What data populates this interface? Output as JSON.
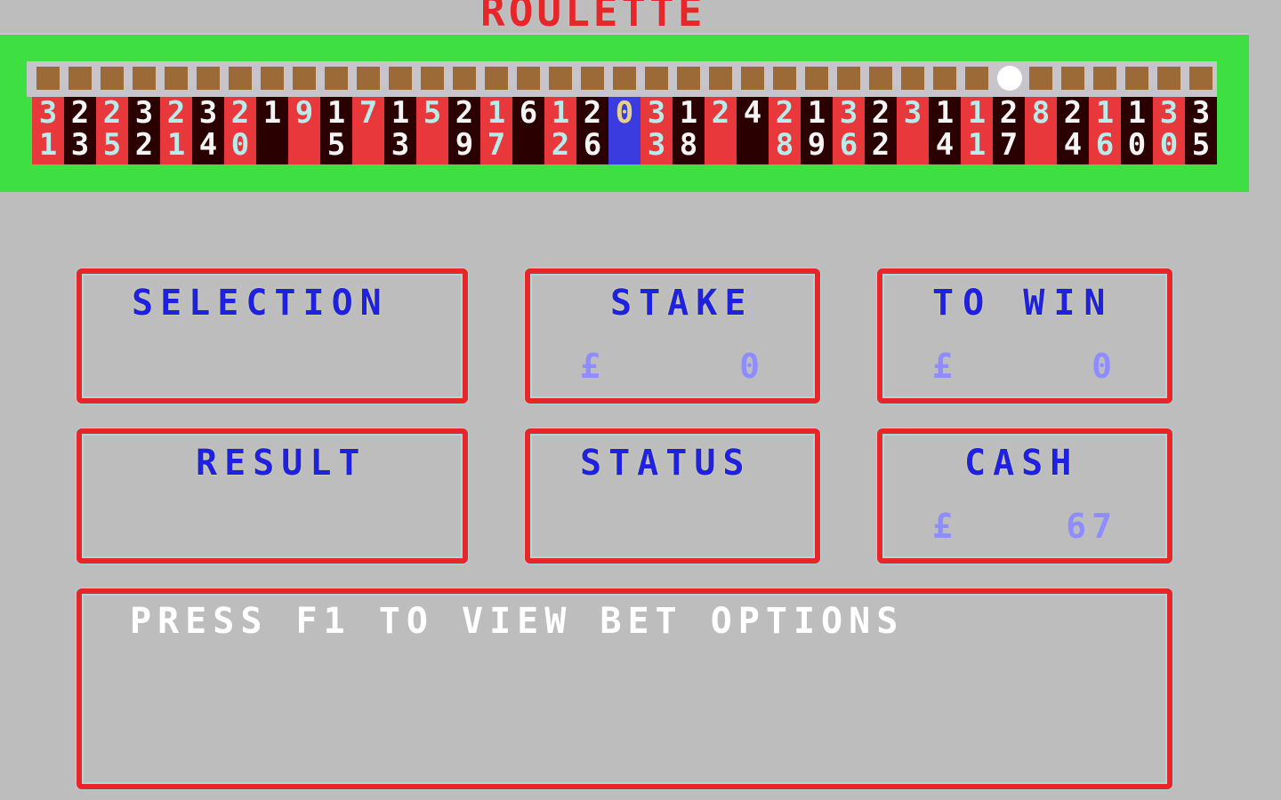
{
  "title": "ROULETTE",
  "wheel": {
    "ball_position_index": 30,
    "pockets": [
      {
        "number": "31",
        "color": "red"
      },
      {
        "number": "23",
        "color": "black"
      },
      {
        "number": "25",
        "color": "red"
      },
      {
        "number": "32",
        "color": "black"
      },
      {
        "number": "21",
        "color": "red"
      },
      {
        "number": "34",
        "color": "black"
      },
      {
        "number": "20",
        "color": "red"
      },
      {
        "number": "1",
        "color": "black"
      },
      {
        "number": "9",
        "color": "red"
      },
      {
        "number": "15",
        "color": "black"
      },
      {
        "number": "7",
        "color": "red"
      },
      {
        "number": "13",
        "color": "black"
      },
      {
        "number": "5",
        "color": "red"
      },
      {
        "number": "29",
        "color": "black"
      },
      {
        "number": "17",
        "color": "red"
      },
      {
        "number": "6",
        "color": "black"
      },
      {
        "number": "12",
        "color": "red"
      },
      {
        "number": "26",
        "color": "black"
      },
      {
        "number": "0",
        "color": "green"
      },
      {
        "number": "33",
        "color": "red"
      },
      {
        "number": "18",
        "color": "black"
      },
      {
        "number": "2",
        "color": "red"
      },
      {
        "number": "4",
        "color": "black"
      },
      {
        "number": "28",
        "color": "red"
      },
      {
        "number": "19",
        "color": "black"
      },
      {
        "number": "36",
        "color": "red"
      },
      {
        "number": "22",
        "color": "black"
      },
      {
        "number": "3",
        "color": "red"
      },
      {
        "number": "14",
        "color": "black"
      },
      {
        "number": "11",
        "color": "red"
      },
      {
        "number": "27",
        "color": "black"
      },
      {
        "number": "8",
        "color": "red"
      },
      {
        "number": "24",
        "color": "black"
      },
      {
        "number": "16",
        "color": "red"
      },
      {
        "number": "10",
        "color": "black"
      },
      {
        "number": "30",
        "color": "red"
      },
      {
        "number": "35",
        "color": "black"
      }
    ]
  },
  "panels": {
    "selection": {
      "label": "SELECTION",
      "value": ""
    },
    "stake": {
      "label": "STAKE",
      "currency": "£",
      "amount": "0"
    },
    "to_win": {
      "label": "TO WIN",
      "currency": "£",
      "amount": "0"
    },
    "result": {
      "label": "RESULT",
      "value": ""
    },
    "status": {
      "label": "STATUS",
      "value": ""
    },
    "cash": {
      "label": "CASH",
      "currency": "£",
      "amount": "67"
    }
  },
  "message": "PRESS F1 TO VIEW BET OPTIONS",
  "colors": {
    "background": "#bdbdbd",
    "table_green": "#3edf42",
    "panel_border": "#e8262a",
    "label_blue": "#1e22e0",
    "value_blue": "#8e8cff",
    "pocket_red": "#e8383c",
    "pocket_black": "#2a0000",
    "pocket_zero": "#3a3ce0"
  }
}
